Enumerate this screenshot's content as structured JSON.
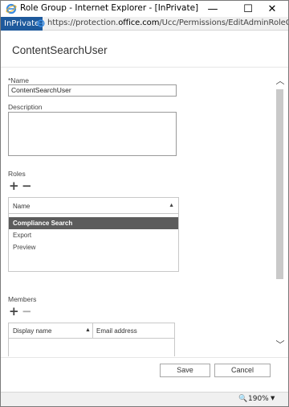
{
  "window": {
    "title": "Role Group - Internet Explorer - [InPrivate]",
    "minimize_glyph": "—",
    "maximize_glyph": "☐",
    "close_glyph": "✕"
  },
  "address_bar": {
    "inprivate_label": "InPrivate",
    "url_prefix": "https://protection.",
    "url_domain": "office.com",
    "url_path": "/Ucc/Permissions/EditAdminRoleGroup.aspx?Activity"
  },
  "dialog": {
    "title": "ContentSearchUser"
  },
  "form": {
    "name_label": "*Name",
    "name_value": "ContentSearchUser",
    "description_label": "Description",
    "description_value": "",
    "roles_label": "Roles",
    "roles_column_name": "Name",
    "roles": [
      {
        "label": "Compliance Search",
        "selected": true
      },
      {
        "label": "Export",
        "selected": false
      },
      {
        "label": "Preview",
        "selected": false
      }
    ],
    "members_label": "Members",
    "members_columns": [
      "Display name",
      "Email address"
    ]
  },
  "icons": {
    "add": "+",
    "remove": "−",
    "sort_up": "▲",
    "scroll_up": "︿",
    "scroll_down": "﹀",
    "zoom": "🔍"
  },
  "footer": {
    "save_label": "Save",
    "cancel_label": "Cancel"
  },
  "status_bar": {
    "zoom_level": "190%",
    "zoom_caret": "▼"
  },
  "colors": {
    "inprivate_bg": "#1e5a9c",
    "selected_row_bg": "#5c5c5c",
    "scroll_thumb": "#c9c9c9"
  }
}
